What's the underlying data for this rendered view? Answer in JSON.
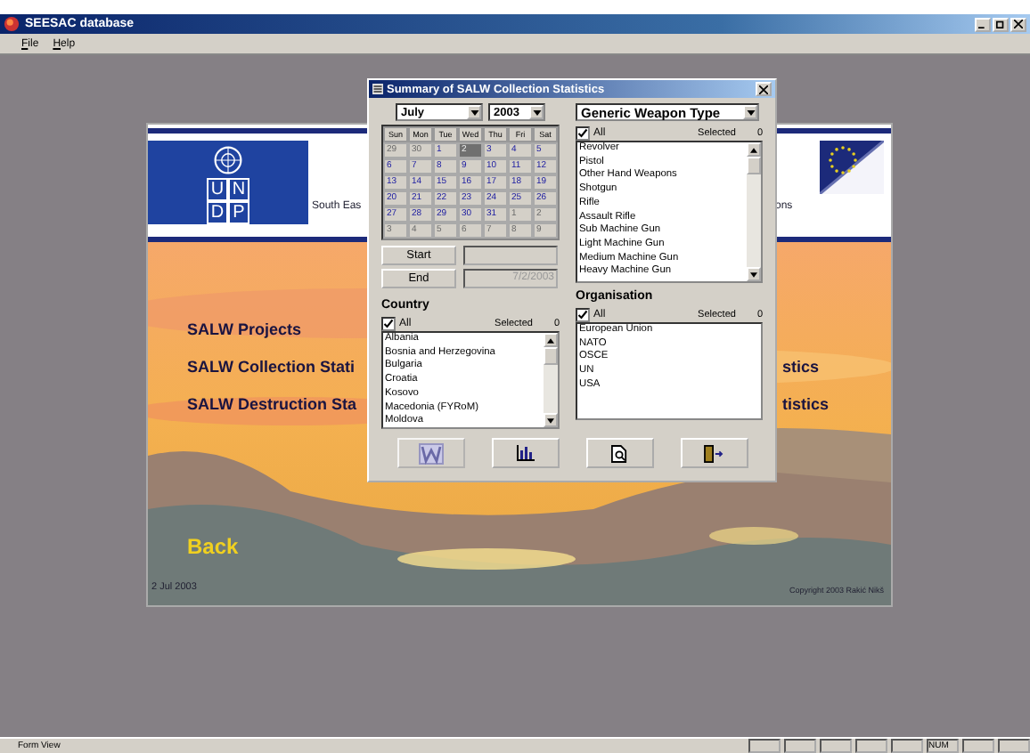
{
  "window": {
    "title": "SEESAC database"
  },
  "menu": [
    "File",
    "Help"
  ],
  "form": {
    "logo_letters": [
      "U",
      "N",
      "D",
      "P"
    ],
    "header_left": "South Eas",
    "header_right": "ons",
    "links": [
      {
        "left": "SALW Projects"
      },
      {
        "left": "SALW Collection Stati",
        "right": "stics"
      },
      {
        "left": "SALW Destruction Sta",
        "right": "tistics"
      }
    ],
    "back": "Back",
    "date": "2 Jul 2003",
    "copyright": "Copyright 2003 Rakić Nikš"
  },
  "dialog": {
    "title": "Summary of SALW Collection Statistics",
    "month": "July",
    "year": "2003",
    "weekdays": [
      "Sun",
      "Mon",
      "Tue",
      "Wed",
      "Thu",
      "Fri",
      "Sat"
    ],
    "days": [
      {
        "label": "29",
        "muted": true,
        "selected": false
      },
      {
        "label": "30",
        "muted": true,
        "selected": false
      },
      {
        "label": "1",
        "muted": false,
        "selected": false
      },
      {
        "label": "2",
        "muted": false,
        "selected": true
      },
      {
        "label": "3",
        "muted": false,
        "selected": false
      },
      {
        "label": "4",
        "muted": false,
        "selected": false
      },
      {
        "label": "5",
        "muted": false,
        "selected": false
      },
      {
        "label": "6",
        "muted": false,
        "selected": false
      },
      {
        "label": "7",
        "muted": false,
        "selected": false
      },
      {
        "label": "8",
        "muted": false,
        "selected": false
      },
      {
        "label": "9",
        "muted": false,
        "selected": false
      },
      {
        "label": "10",
        "muted": false,
        "selected": false
      },
      {
        "label": "11",
        "muted": false,
        "selected": false
      },
      {
        "label": "12",
        "muted": false,
        "selected": false
      },
      {
        "label": "13",
        "muted": false,
        "selected": false
      },
      {
        "label": "14",
        "muted": false,
        "selected": false
      },
      {
        "label": "15",
        "muted": false,
        "selected": false
      },
      {
        "label": "16",
        "muted": false,
        "selected": false
      },
      {
        "label": "17",
        "muted": false,
        "selected": false
      },
      {
        "label": "18",
        "muted": false,
        "selected": false
      },
      {
        "label": "19",
        "muted": false,
        "selected": false
      },
      {
        "label": "20",
        "muted": false,
        "selected": false
      },
      {
        "label": "21",
        "muted": false,
        "selected": false
      },
      {
        "label": "22",
        "muted": false,
        "selected": false
      },
      {
        "label": "23",
        "muted": false,
        "selected": false
      },
      {
        "label": "24",
        "muted": false,
        "selected": false
      },
      {
        "label": "25",
        "muted": false,
        "selected": false
      },
      {
        "label": "26",
        "muted": false,
        "selected": false
      },
      {
        "label": "27",
        "muted": false,
        "selected": false
      },
      {
        "label": "28",
        "muted": false,
        "selected": false
      },
      {
        "label": "29",
        "muted": false,
        "selected": false
      },
      {
        "label": "30",
        "muted": false,
        "selected": false
      },
      {
        "label": "31",
        "muted": false,
        "selected": false
      },
      {
        "label": "1",
        "muted": true,
        "selected": false
      },
      {
        "label": "2",
        "muted": true,
        "selected": false
      },
      {
        "label": "3",
        "muted": true,
        "selected": false
      },
      {
        "label": "4",
        "muted": true,
        "selected": false
      },
      {
        "label": "5",
        "muted": true,
        "selected": false
      },
      {
        "label": "6",
        "muted": true,
        "selected": false
      },
      {
        "label": "7",
        "muted": true,
        "selected": false
      },
      {
        "label": "8",
        "muted": true,
        "selected": false
      },
      {
        "label": "9",
        "muted": true,
        "selected": false
      }
    ],
    "start": {
      "label": "Start"
    },
    "end": {
      "label": "End",
      "value": "7/2/2003",
      "disabled": true
    },
    "weapon": {
      "type": "Generic Weapon Type",
      "all_label": "All",
      "all_checked": true,
      "selected_label": "Selected",
      "selected_count": "0",
      "items": [
        "Revolver",
        "Pistol",
        "Other Hand Weapons",
        "Shotgun",
        "Rifle",
        "Assault Rifle",
        "Sub Machine Gun",
        "Light Machine Gun",
        "Medium Machine Gun",
        "Heavy Machine Gun"
      ]
    },
    "country": {
      "title": "Country",
      "all_label": "All",
      "all_checked": true,
      "selected_label": "Selected",
      "selected_count": "0",
      "items": [
        "Albania",
        "Bosnia and Herzegovina",
        "Bulgaria",
        "Croatia",
        "Kosovo",
        "Macedonia (FYRoM)",
        "Moldova"
      ]
    },
    "organisation": {
      "title": "Organisation",
      "all_label": "All",
      "all_checked": true,
      "selected_label": "Selected",
      "selected_count": "0",
      "items": [
        "European Union",
        "NATO",
        "OSCE",
        "UN",
        "USA"
      ]
    },
    "buttons": [
      {
        "kind": "word"
      },
      {
        "kind": "chart"
      },
      {
        "kind": "preview"
      },
      {
        "kind": "exit"
      }
    ]
  },
  "status_bar": {
    "text": "Form View",
    "indicators": [
      "NUM"
    ]
  }
}
